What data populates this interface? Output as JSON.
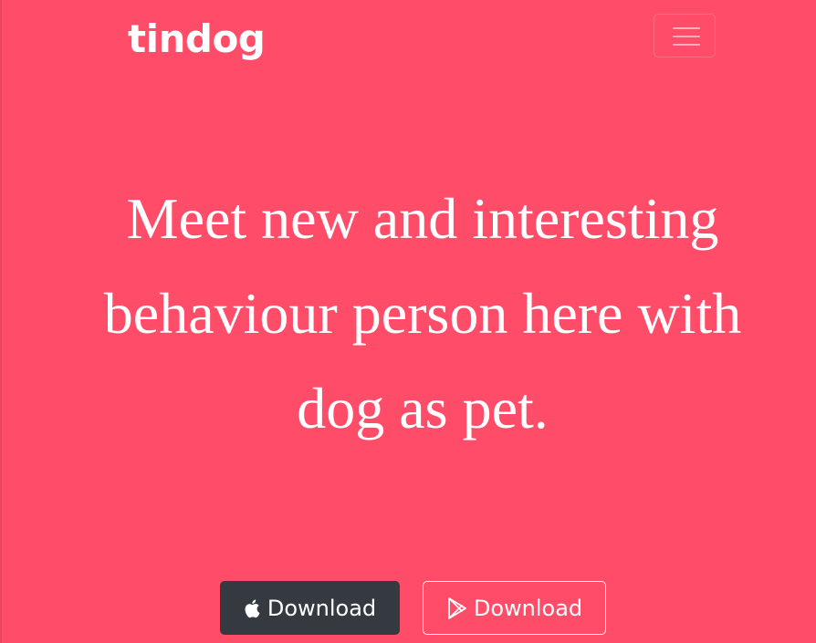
{
  "navbar": {
    "brand": "tindog",
    "toggler_icon": "hamburger-menu-icon"
  },
  "hero": {
    "headline": "Meet new and interesting behaviour person here with dog as pet.",
    "buttons": [
      {
        "label": "Download",
        "icon": "apple-icon",
        "style": "dark"
      },
      {
        "label": "Download",
        "icon": "google-play-icon",
        "style": "outline-light"
      }
    ]
  },
  "colors": {
    "background": "#ff4c68",
    "dark_button": "#343a40",
    "text": "#ffffff"
  }
}
